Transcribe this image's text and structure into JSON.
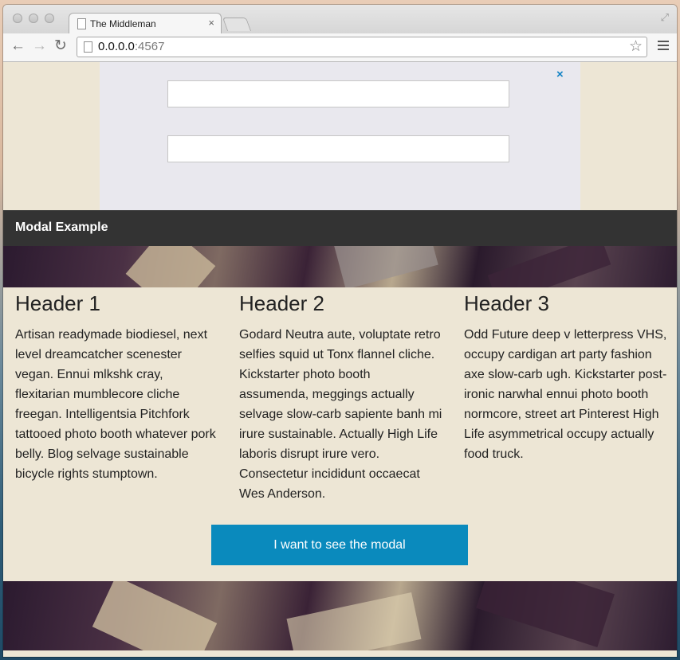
{
  "browser": {
    "tab_title": "The Middleman",
    "tab_close": "×",
    "url_host": "0.0.0.0",
    "url_port": ":4567",
    "back": "←",
    "forward": "→",
    "reload": "↻",
    "star": "☆",
    "fullscreen": "⤢"
  },
  "modal": {
    "close_label": "×",
    "field1_value": "",
    "field2_value": ""
  },
  "topbar": {
    "title": "Modal Example"
  },
  "columns": [
    {
      "header": "Header 1",
      "text": "Artisan readymade biodiesel, next level dreamcatcher scenester vegan. Ennui mlkshk cray, flexitarian mumblecore cliche freegan. Intelligentsia Pitchfork tattooed photo booth whatever pork belly. Blog selvage sustainable bicycle rights stumptown."
    },
    {
      "header": "Header 2",
      "text": "Godard Neutra aute, voluptate retro selfies squid ut Tonx flannel cliche. Kickstarter photo booth assumenda, meggings actually selvage slow-carb sapiente banh mi irure sustainable. Actually High Life laboris disrupt irure vero. Consectetur incididunt occaecat Wes Anderson."
    },
    {
      "header": "Header 3",
      "text": "Odd Future deep v letterpress VHS, occupy cardigan art party fashion axe slow-carb ugh. Kickstarter post-ironic narwhal ennui photo booth normcore, street art Pinterest High Life asymmetrical occupy actually food truck."
    }
  ],
  "cta": {
    "label": "I want to see the modal"
  },
  "colors": {
    "page_bg": "#ede6d5",
    "topbar_bg": "#333333",
    "modal_bg": "#e9e8ee",
    "accent": "#0a8abd",
    "close_icon": "#1282c4"
  },
  "icons": {
    "tab": "document-icon",
    "address": "document-icon",
    "menu": "hamburger-menu-icon"
  }
}
